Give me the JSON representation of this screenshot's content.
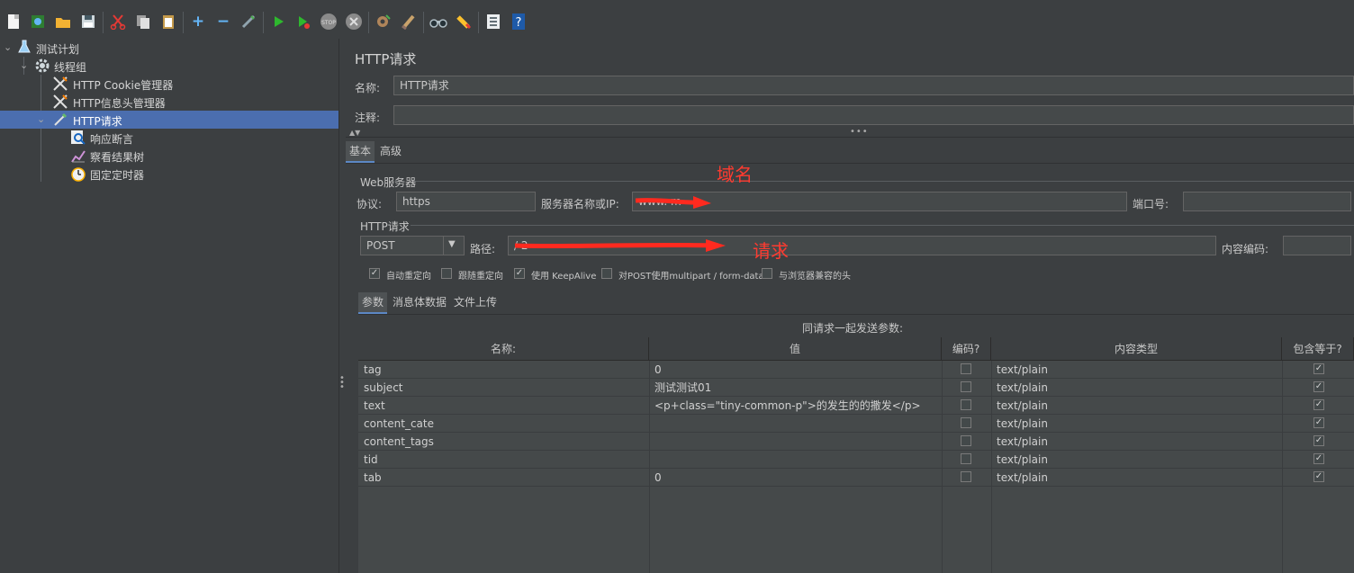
{
  "toolbar": {
    "icons": [
      "new-icon",
      "templates-icon",
      "open-icon",
      "save-icon",
      "cut-icon",
      "copy-icon",
      "paste-icon",
      "expand-icon",
      "collapse-icon",
      "toggle-icon",
      "start-icon",
      "start-no-pause-icon",
      "stop-icon",
      "shutdown-icon",
      "clear-icon",
      "clear-all-icon",
      "search-icon",
      "reset-search-icon",
      "function-helper-icon",
      "help-icon"
    ]
  },
  "tree": {
    "items": [
      {
        "label": "测试计划",
        "icon": "test-plan-icon"
      },
      {
        "label": "线程组",
        "icon": "gear-icon"
      },
      {
        "label": "HTTP Cookie管理器",
        "icon": "tools-icon"
      },
      {
        "label": "HTTP信息头管理器",
        "icon": "tools-icon"
      },
      {
        "label": "HTTP请求",
        "icon": "pipette-icon"
      },
      {
        "label": "响应断言",
        "icon": "magnifier-icon"
      },
      {
        "label": "察看结果树",
        "icon": "chart-icon"
      },
      {
        "label": "固定定时器",
        "icon": "timer-icon"
      }
    ]
  },
  "panel": {
    "title": "HTTP请求",
    "name_label": "名称:",
    "name_value": "HTTP请求",
    "comment_label": "注释:",
    "comment_value": ""
  },
  "tabs": {
    "basic": "基本",
    "advanced": "高级"
  },
  "web_server": {
    "group": "Web服务器",
    "protocol_label": "协议:",
    "protocol_value": "https",
    "server_label": "服务器名称或IP:",
    "server_value": "www.             m",
    "port_label": "端口号:",
    "port_value": ""
  },
  "annotations": {
    "domain": "域名",
    "request": "请求"
  },
  "http_request": {
    "group": "HTTP请求",
    "method": "POST",
    "path_label": "路径:",
    "path_value": "/                              2",
    "encoding_label": "内容编码:",
    "encoding_value": "",
    "options": [
      {
        "label": "自动重定向",
        "checked": true
      },
      {
        "label": "跟随重定向",
        "checked": false
      },
      {
        "label": "使用 KeepAlive",
        "checked": true
      },
      {
        "label": "对POST使用multipart / form-data",
        "checked": false
      },
      {
        "label": "与浏览器兼容的头",
        "checked": false
      }
    ]
  },
  "sub_tabs": {
    "params": "参数",
    "body": "消息体数据",
    "files": "文件上传"
  },
  "params_table": {
    "caption": "同请求一起发送参数:",
    "headers": [
      "名称:",
      "值",
      "编码?",
      "内容类型",
      "包含等于?"
    ],
    "rows": [
      {
        "name": "tag",
        "value": "0",
        "encode": false,
        "type": "text/plain",
        "include_eq": true
      },
      {
        "name": "subject",
        "value": "测试测试01",
        "encode": false,
        "type": "text/plain",
        "include_eq": true
      },
      {
        "name": "text",
        "value": "<p+class=\"tiny-common-p\">的发生的的撒发</p>",
        "encode": false,
        "type": "text/plain",
        "include_eq": true
      },
      {
        "name": "content_cate",
        "value": "",
        "encode": false,
        "type": "text/plain",
        "include_eq": true
      },
      {
        "name": "content_tags",
        "value": "",
        "encode": false,
        "type": "text/plain",
        "include_eq": true
      },
      {
        "name": "tid",
        "value": "",
        "encode": false,
        "type": "text/plain",
        "include_eq": true
      },
      {
        "name": "tab",
        "value": "0",
        "encode": false,
        "type": "text/plain",
        "include_eq": true
      }
    ]
  }
}
